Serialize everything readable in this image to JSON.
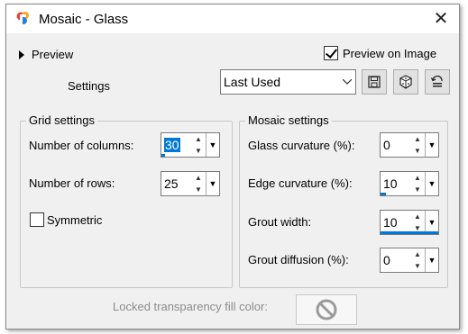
{
  "window": {
    "title": "Mosaic - Glass",
    "close_glyph": "✕"
  },
  "top": {
    "preview_label": "Preview",
    "preview_on_image_label": "Preview on Image",
    "preview_on_image_checked": true
  },
  "settings": {
    "label": "Settings",
    "preset_value": "Last Used",
    "buttons": [
      "save-icon",
      "randomize-dice-icon",
      "reset-icon"
    ]
  },
  "grid": {
    "title": "Grid settings",
    "columns_label": "Number of columns:",
    "columns_value": "30",
    "rows_label": "Number of rows:",
    "rows_value": "25",
    "symmetric_label": "Symmetric",
    "symmetric_checked": false
  },
  "mosaic": {
    "title": "Mosaic settings",
    "glass_curvature_label": "Glass curvature (%):",
    "glass_curvature_value": "0",
    "edge_curvature_label": "Edge curvature (%):",
    "edge_curvature_value": "10",
    "grout_width_label": "Grout width:",
    "grout_width_value": "10",
    "grout_diffusion_label": "Grout diffusion (%):",
    "grout_diffusion_value": "0"
  },
  "locked": {
    "label": "Locked transparency fill color:",
    "icon": "no-symbol-icon"
  },
  "colors": {
    "accent": "#0078d7",
    "dialog_bg": "#f0f0f0",
    "disabled_text": "#8c8c8c"
  }
}
